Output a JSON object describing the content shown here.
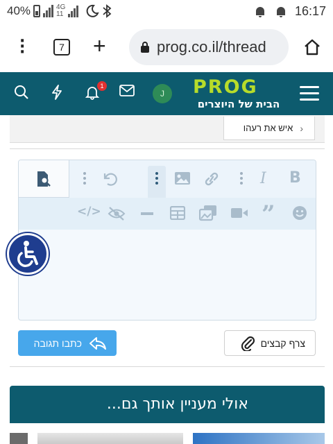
{
  "status_bar": {
    "battery_percent": "40%",
    "network": "4G",
    "network_sub": "11",
    "time": "16:17"
  },
  "browser": {
    "tab_count": "7",
    "url": "prog.co.il/thread"
  },
  "site_header": {
    "logo_text": "PROG",
    "logo_tagline": "הבית של היוצרים",
    "notification_count": "1",
    "avatar_letter": "J"
  },
  "quote": {
    "label": "איש את רעהו"
  },
  "actions": {
    "attach_label": "צרף קבצים",
    "reply_label": "כתבו תגובה"
  },
  "interest": {
    "title": "אולי מעניין אותך גם..."
  },
  "colors": {
    "header_bg": "#0d5b6e",
    "logo_accent": "#b7dc2a",
    "reply_button": "#47a7eb",
    "accessibility_bg": "#1f3d8f"
  }
}
